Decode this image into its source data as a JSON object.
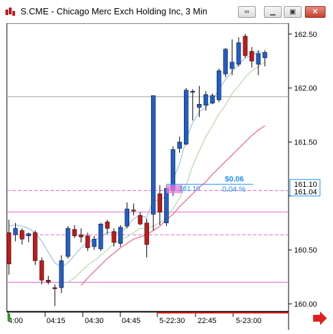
{
  "window": {
    "title": "S.CME - Chicago Merc Exch Holding Inc, 3 Min",
    "buttons": [
      "link-icon",
      "minimize-icon",
      "maximize-icon",
      "close-icon"
    ]
  },
  "chart_data": {
    "type": "candlestick",
    "title": "S.CME - Chicago Merc Exch Holding Inc, 3 Min",
    "y_axis": {
      "min": 159.93,
      "max": 162.6,
      "ticks": [
        160.0,
        160.5,
        161.0,
        161.5,
        162.0,
        162.5
      ],
      "tick_labels": [
        "160.00",
        "160.50",
        "",
        "161.50",
        "162.00",
        "162.50"
      ]
    },
    "x_axis": {
      "labels": [
        "4:00",
        "04:15",
        "04:30",
        "04:45",
        "5-22:30",
        "22:45",
        "5-23:00"
      ]
    },
    "colors": {
      "up": "#1f5fc8",
      "down": "#c01a1a",
      "ma_fast": "#9ec4ea",
      "ma_slow": "#b8dcb0",
      "ma_long": "#f06088",
      "level_line": "#e060c8",
      "grid": "#d9d9d9",
      "accent": "#1e90ff"
    },
    "candles": [
      {
        "o": 160.66,
        "h": 160.78,
        "l": 160.27,
        "c": 160.37
      },
      {
        "o": 160.64,
        "h": 160.75,
        "l": 160.58,
        "c": 160.7
      },
      {
        "o": 160.68,
        "h": 160.7,
        "l": 160.55,
        "c": 160.6
      },
      {
        "o": 160.63,
        "h": 160.66,
        "l": 160.57,
        "c": 160.65
      },
      {
        "o": 160.66,
        "h": 160.68,
        "l": 160.36,
        "c": 160.4
      },
      {
        "o": 160.4,
        "h": 160.43,
        "l": 160.18,
        "c": 160.22
      },
      {
        "o": 160.22,
        "h": 160.26,
        "l": 160.18,
        "c": 160.2
      },
      {
        "o": 160.15,
        "h": 160.18,
        "l": 159.98,
        "c": 160.14
      },
      {
        "o": 160.15,
        "h": 160.45,
        "l": 160.1,
        "c": 160.4
      },
      {
        "o": 160.44,
        "h": 160.72,
        "l": 160.42,
        "c": 160.7
      },
      {
        "o": 160.69,
        "h": 160.73,
        "l": 160.61,
        "c": 160.63
      },
      {
        "o": 160.64,
        "h": 160.7,
        "l": 160.57,
        "c": 160.62
      },
      {
        "o": 160.63,
        "h": 160.66,
        "l": 160.49,
        "c": 160.52
      },
      {
        "o": 160.53,
        "h": 160.63,
        "l": 160.5,
        "c": 160.6
      },
      {
        "o": 160.51,
        "h": 160.75,
        "l": 160.49,
        "c": 160.74
      },
      {
        "o": 160.76,
        "h": 160.78,
        "l": 160.65,
        "c": 160.7
      },
      {
        "o": 160.67,
        "h": 160.7,
        "l": 160.53,
        "c": 160.57
      },
      {
        "o": 160.56,
        "h": 160.73,
        "l": 160.53,
        "c": 160.71
      },
      {
        "o": 160.72,
        "h": 160.94,
        "l": 160.7,
        "c": 160.88
      },
      {
        "o": 160.87,
        "h": 160.93,
        "l": 160.82,
        "c": 160.86
      },
      {
        "o": 160.82,
        "h": 160.85,
        "l": 160.73,
        "c": 160.74
      },
      {
        "o": 160.75,
        "h": 160.79,
        "l": 160.43,
        "c": 160.55
      },
      {
        "o": 160.83,
        "h": 161.93,
        "l": 160.68,
        "c": 161.93
      },
      {
        "o": 161.02,
        "h": 161.1,
        "l": 160.73,
        "c": 160.85
      },
      {
        "o": 160.75,
        "h": 161.1,
        "l": 160.72,
        "c": 161.07
      },
      {
        "o": 161.05,
        "h": 161.46,
        "l": 161.0,
        "c": 161.43
      },
      {
        "o": 161.44,
        "h": 161.55,
        "l": 161.4,
        "c": 161.5
      },
      {
        "o": 161.48,
        "h": 162.0,
        "l": 161.47,
        "c": 161.98
      },
      {
        "o": 161.96,
        "h": 161.99,
        "l": 161.7,
        "c": 161.97
      },
      {
        "o": 161.82,
        "h": 162.02,
        "l": 161.73,
        "c": 161.85
      },
      {
        "o": 161.84,
        "h": 161.97,
        "l": 161.79,
        "c": 161.94
      },
      {
        "o": 161.86,
        "h": 161.95,
        "l": 161.85,
        "c": 161.93
      },
      {
        "o": 161.89,
        "h": 162.18,
        "l": 161.87,
        "c": 162.16
      },
      {
        "o": 162.13,
        "h": 162.37,
        "l": 162.1,
        "c": 162.36
      },
      {
        "o": 162.18,
        "h": 162.45,
        "l": 162.12,
        "c": 162.24
      },
      {
        "o": 162.22,
        "h": 162.47,
        "l": 162.2,
        "c": 162.42
      },
      {
        "o": 162.48,
        "h": 162.5,
        "l": 162.28,
        "c": 162.3
      },
      {
        "o": 162.34,
        "h": 162.38,
        "l": 162.19,
        "c": 162.25
      },
      {
        "o": 162.22,
        "h": 162.35,
        "l": 162.12,
        "c": 162.32
      },
      {
        "o": 162.28,
        "h": 162.35,
        "l": 162.2,
        "c": 162.33
      }
    ],
    "ma_fast": [
      160.72,
      160.73,
      160.72,
      160.7,
      160.66,
      160.58,
      160.48,
      160.38,
      160.34,
      160.38,
      160.45,
      160.52,
      160.57,
      160.59,
      160.62,
      160.66,
      160.66,
      160.66,
      160.72,
      160.79,
      160.82,
      160.8,
      160.96,
      160.96,
      161.0,
      161.15,
      161.3,
      161.52,
      161.68,
      161.78,
      161.82,
      161.88,
      161.99,
      162.08,
      162.15,
      162.22,
      162.28,
      162.3,
      162.34,
      162.32
    ],
    "ma_slow": [
      null,
      null,
      null,
      null,
      null,
      null,
      null,
      null,
      null,
      160.2,
      160.24,
      160.3,
      160.36,
      160.4,
      160.45,
      160.5,
      160.56,
      160.6,
      160.62,
      160.66,
      160.7,
      160.7,
      160.72,
      160.75,
      160.8,
      160.88,
      160.98,
      161.1,
      161.28,
      161.42,
      161.55,
      161.65,
      161.76,
      161.84,
      161.95,
      162.02,
      162.1,
      162.16,
      162.2,
      162.24
    ],
    "ma_long": [
      null,
      null,
      null,
      null,
      null,
      null,
      null,
      null,
      null,
      null,
      null,
      160.17,
      160.24,
      160.3,
      160.36,
      160.42,
      160.47,
      160.52,
      160.56,
      160.6,
      160.62,
      160.64,
      160.68,
      160.72,
      160.78,
      160.83,
      160.9,
      160.96,
      161.02,
      161.08,
      161.13,
      161.2,
      161.26,
      161.32,
      161.38,
      161.44,
      161.5,
      161.56,
      161.61,
      161.65
    ],
    "level_lines": {
      "gray": 161.92,
      "solid_pink": [
        160.85,
        160.2
      ],
      "dashed_pink": [
        161.05,
        160.64
      ]
    },
    "current_price": {
      "label": "161.10",
      "sub_label": "161.04",
      "value": 161.07
    },
    "measure": {
      "dollar": "$0.06",
      "percent": "0.04 %",
      "start_label": "161.10"
    }
  }
}
